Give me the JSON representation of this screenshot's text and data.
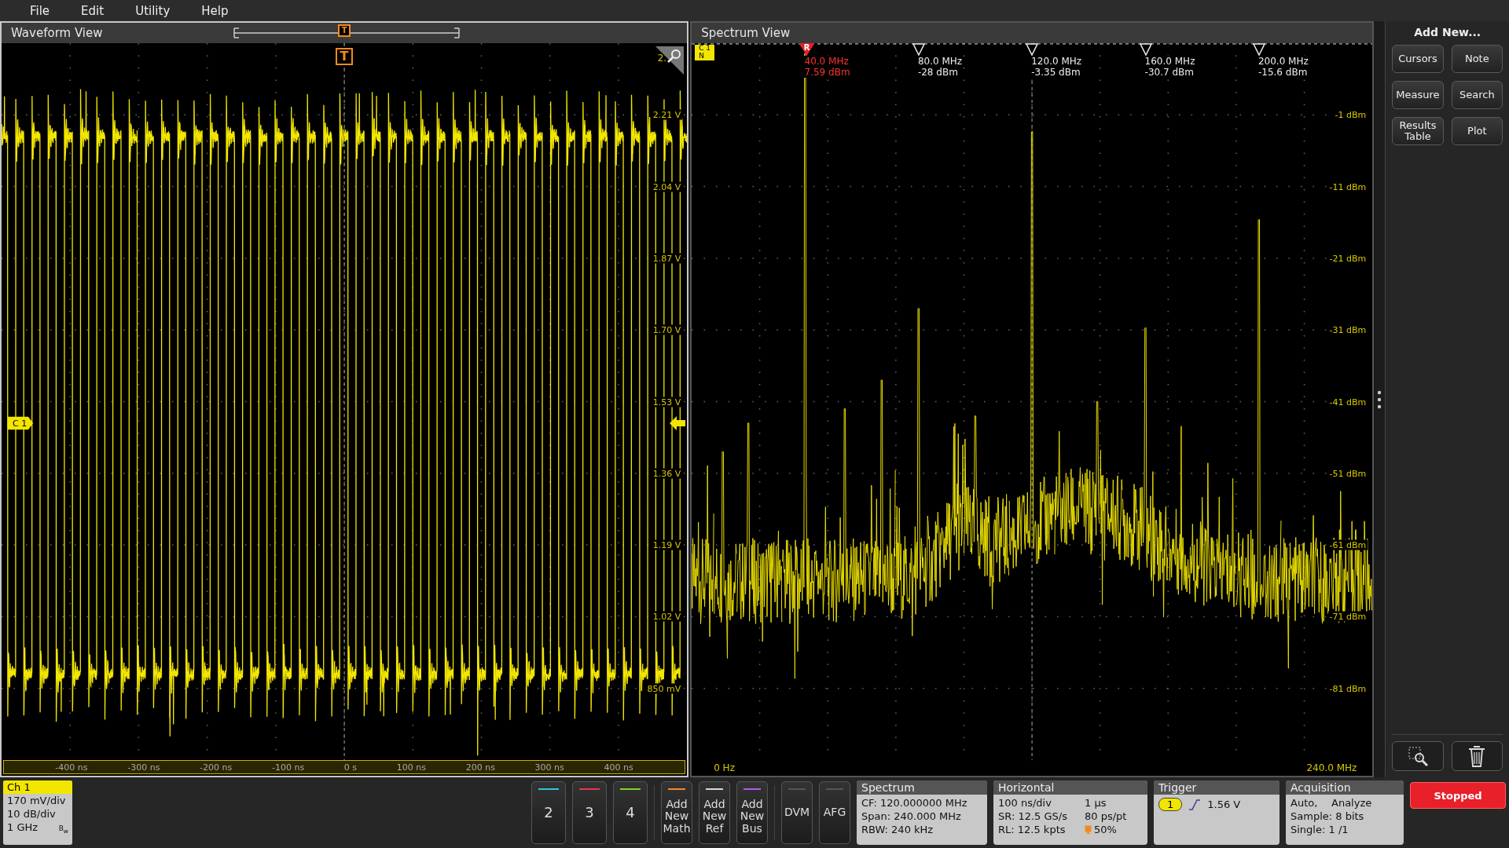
{
  "menu": [
    "File",
    "Edit",
    "Utility",
    "Help"
  ],
  "waveform_view": {
    "title": "Waveform View",
    "trigger_labels": [
      "T",
      "T"
    ],
    "channel_badge": "C 1",
    "top_label": "2.",
    "y_labels": [
      "2.21 V",
      "2.04 V",
      "1.87 V",
      "1.70 V",
      "1.53 V",
      "1.36 V",
      "1.19 V",
      "1.02 V",
      "850 mV"
    ],
    "x_labels": [
      "-400 ns",
      "-300 ns",
      "-200 ns",
      "-100 ns",
      "0 s",
      "100 ns",
      "200 ns",
      "300 ns",
      "400 ns"
    ]
  },
  "spectrum_view": {
    "title": "Spectrum View",
    "channel_badge": [
      "C 1",
      "N"
    ],
    "markers": [
      {
        "kind": "reference",
        "flag": "R",
        "frequency": "40.0 MHz",
        "level_text": "7.59 dBm"
      },
      {
        "kind": "delta",
        "frequency": "80.0 MHz",
        "level_text": "-28 dBm"
      },
      {
        "kind": "delta",
        "frequency": "120.0 MHz",
        "level_text": "-3.35 dBm"
      },
      {
        "kind": "delta",
        "frequency": "160.0 MHz",
        "level_text": "-30.7 dBm"
      },
      {
        "kind": "delta",
        "frequency": "200.0 MHz",
        "level_text": "-15.6 dBm"
      }
    ],
    "y_labels": [
      "-1 dBm",
      "-11 dBm",
      "-21 dBm",
      "-31 dBm",
      "-41 dBm",
      "-51 dBm",
      "-61 dBm",
      "-71 dBm",
      "-81 dBm"
    ],
    "x_start": "0 Hz",
    "x_end": "240.0 MHz"
  },
  "side_panel": {
    "title": "Add New...",
    "buttons": [
      "Cursors",
      "Note",
      "Measure",
      "Search",
      "Results Table",
      "Plot"
    ]
  },
  "bottom_bar": {
    "channel": {
      "name": "Ch 1",
      "lines": [
        "170 mV/div",
        "10 dB/div",
        "1 GHz"
      ],
      "bw_mark": "B$_{w}$"
    },
    "channel_buttons": [
      {
        "label": "2",
        "color": "#2ec8d8"
      },
      {
        "label": "3",
        "color": "#e8384f"
      },
      {
        "label": "4",
        "color": "#7ed321"
      }
    ],
    "add_buttons": [
      {
        "label": "Add New Math",
        "color": "#f0892a"
      },
      {
        "label": "Add New Ref",
        "color": "#d8d8d8"
      },
      {
        "label": "Add New Bus",
        "color": "#b45ce0"
      }
    ],
    "tools": [
      "DVM",
      "AFG"
    ],
    "spectrum": {
      "title": "Spectrum",
      "lines": [
        "CF: 120.000000 MHz",
        "Span: 240.000 MHz",
        "RBW: 240 kHz"
      ]
    },
    "horizontal": {
      "title": "Horizontal",
      "rows": [
        [
          "100 ns/div",
          "1 µs"
        ],
        [
          "SR: 12.5 GS/s",
          "80 ps/pt"
        ],
        [
          "RL: 12.5 kpts",
          "50%"
        ]
      ]
    },
    "trigger": {
      "title": "Trigger",
      "source": "1",
      "level": "1.56 V"
    },
    "acquisition": {
      "title": "Acquisition",
      "rows": [
        [
          "Auto,",
          "Analyze"
        ],
        [
          "Sample: 8 bits"
        ],
        [
          "Single: 1 /1"
        ]
      ]
    },
    "run_state": "Stopped"
  }
}
